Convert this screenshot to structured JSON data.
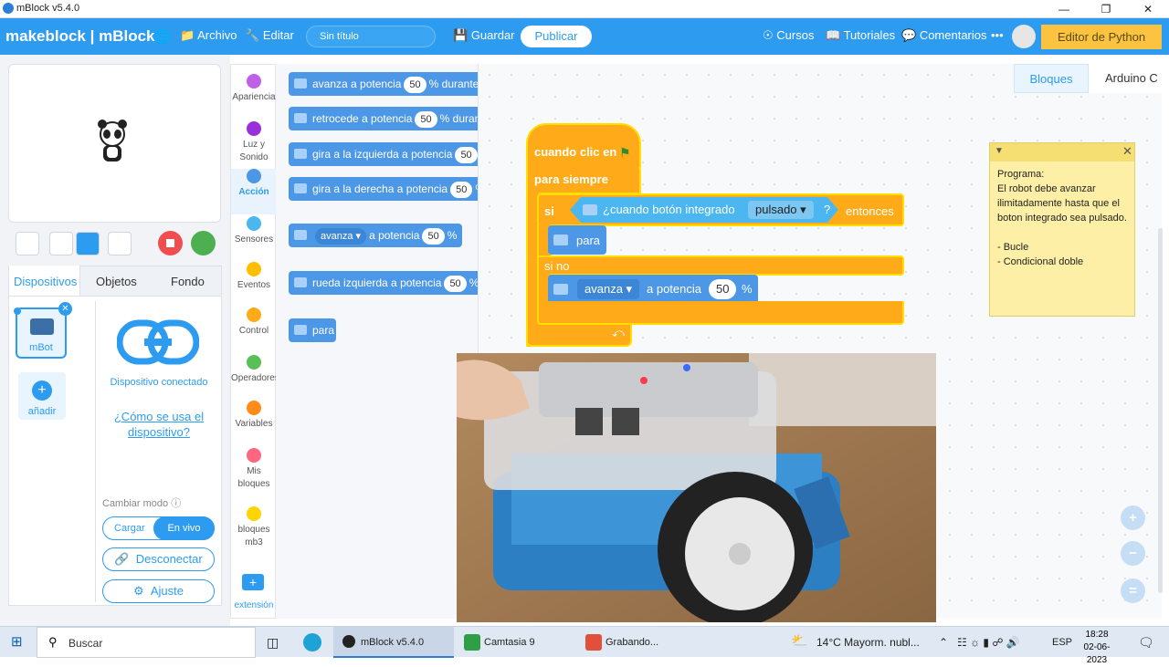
{
  "window": {
    "title": "mBlock v5.4.0"
  },
  "menubar": {
    "logo": "makeblock | mBlock",
    "archivo": "Archivo",
    "editar": "Editar",
    "project_title": "Sin título",
    "guardar": "Guardar",
    "publicar": "Publicar",
    "cursos": "Cursos",
    "tutoriales": "Tutoriales",
    "comentarios": "Comentarios",
    "more": "•••",
    "python": "Editor de Python"
  },
  "left": {
    "tabs": [
      "Dispositivos",
      "Objetos",
      "Fondo"
    ],
    "device_name": "mBot",
    "add_label": "añadir",
    "connected": "Dispositivo conectado",
    "how_to": "¿Cómo se usa el dispositivo?",
    "mode_label": "Cambiar modo",
    "mode_cargar": "Cargar",
    "mode_envivo": "En vivo",
    "disconnect": "Desconectar",
    "settings": "Ajuste"
  },
  "categories": [
    {
      "label": "Apariencia",
      "color": "#c060e6"
    },
    {
      "label": "Luz y Sonido",
      "color": "#9a30d9"
    },
    {
      "label": "Acción",
      "color": "#4c97e6"
    },
    {
      "label": "Sensores",
      "color": "#4cb6f0"
    },
    {
      "label": "Eventos",
      "color": "#ffbf00"
    },
    {
      "label": "Control",
      "color": "#ffab19"
    },
    {
      "label": "Operadores",
      "color": "#59c059"
    },
    {
      "label": "Variables",
      "color": "#ff8c1a"
    },
    {
      "label": "Mis bloques",
      "color": "#ff6680"
    },
    {
      "label": "bloques mb3",
      "color": "#ffd400"
    }
  ],
  "extension_label": "extensión",
  "palette": {
    "b1": {
      "a": "avanza a potencia",
      "n": "50",
      "b": "% durante"
    },
    "b2": {
      "a": "retrocede a potencia",
      "n": "50",
      "b": "% durant"
    },
    "b3": {
      "a": "gira a la izquierda a potencia",
      "n": "50",
      "b": "%"
    },
    "b4": {
      "a": "gira a la derecha a potencia",
      "n": "50",
      "b": "%"
    },
    "b5": {
      "dd": "avanza ▾",
      "a": "a potencia",
      "n": "50",
      "b": "%"
    },
    "b6": {
      "a": "rueda izquierda a potencia",
      "n": "50",
      "b": "%,"
    },
    "b7": {
      "a": "para"
    }
  },
  "workspace": {
    "tabs": [
      "Bloques",
      "Arduino C"
    ],
    "hat": "cuando clic en",
    "forever": "para siempre",
    "si": "si",
    "cond": "¿cuando botón integrado",
    "cond_dd": "pulsado ▾",
    "cond_q": "?",
    "entonces": "entonces",
    "stop": "para",
    "sino": "si no",
    "move_dd": "avanza ▾",
    "move_a": "a potencia",
    "move_n": "50",
    "move_pct": "%"
  },
  "note": {
    "text": "Programa:\nEl robot debe avanzar ilimitadamente hasta que el boton integrado sea pulsado.\n\n- Bucle\n- Condicional doble"
  },
  "taskbar": {
    "search": "Buscar",
    "app1": "mBlock v5.4.0",
    "app2": "Camtasia 9",
    "app3": "Grabando...",
    "weather": "14°C  Mayorm. nubl...",
    "lang": "ESP",
    "time": "18:28",
    "date": "02-06-2023"
  },
  "colors": {
    "accent": "#2d9cf0",
    "motion": "#4c97e6",
    "control": "#ffab19",
    "python": "#fbc340"
  }
}
